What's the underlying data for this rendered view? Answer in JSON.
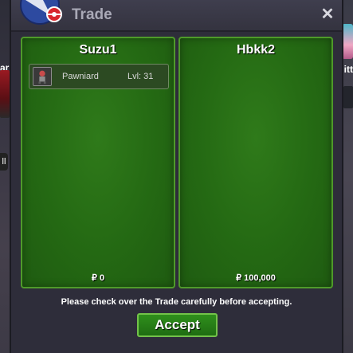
{
  "window": {
    "title": "Trade",
    "close_glyph": "✕",
    "notice": "Please check over the Trade carefully before accepting.",
    "accept_label": "Accept"
  },
  "trade": {
    "left": {
      "player": "Suzu1",
      "money": "₽ 0",
      "items": [
        {
          "icon": "pokemon-sprite-icon",
          "name": "Pawniard",
          "level": "Lvl: 31"
        }
      ]
    },
    "right": {
      "player": "Hbkk2",
      "money": "₽ 100,000",
      "items": []
    }
  },
  "background": {
    "left_text": "ar",
    "left_pill": "ll",
    "right_text": "itt"
  },
  "colors": {
    "panel_green": "#246913",
    "panel_border": "#4f9a2a",
    "window_bg": "#2e2d3a",
    "accept_border": "#73c24a"
  }
}
